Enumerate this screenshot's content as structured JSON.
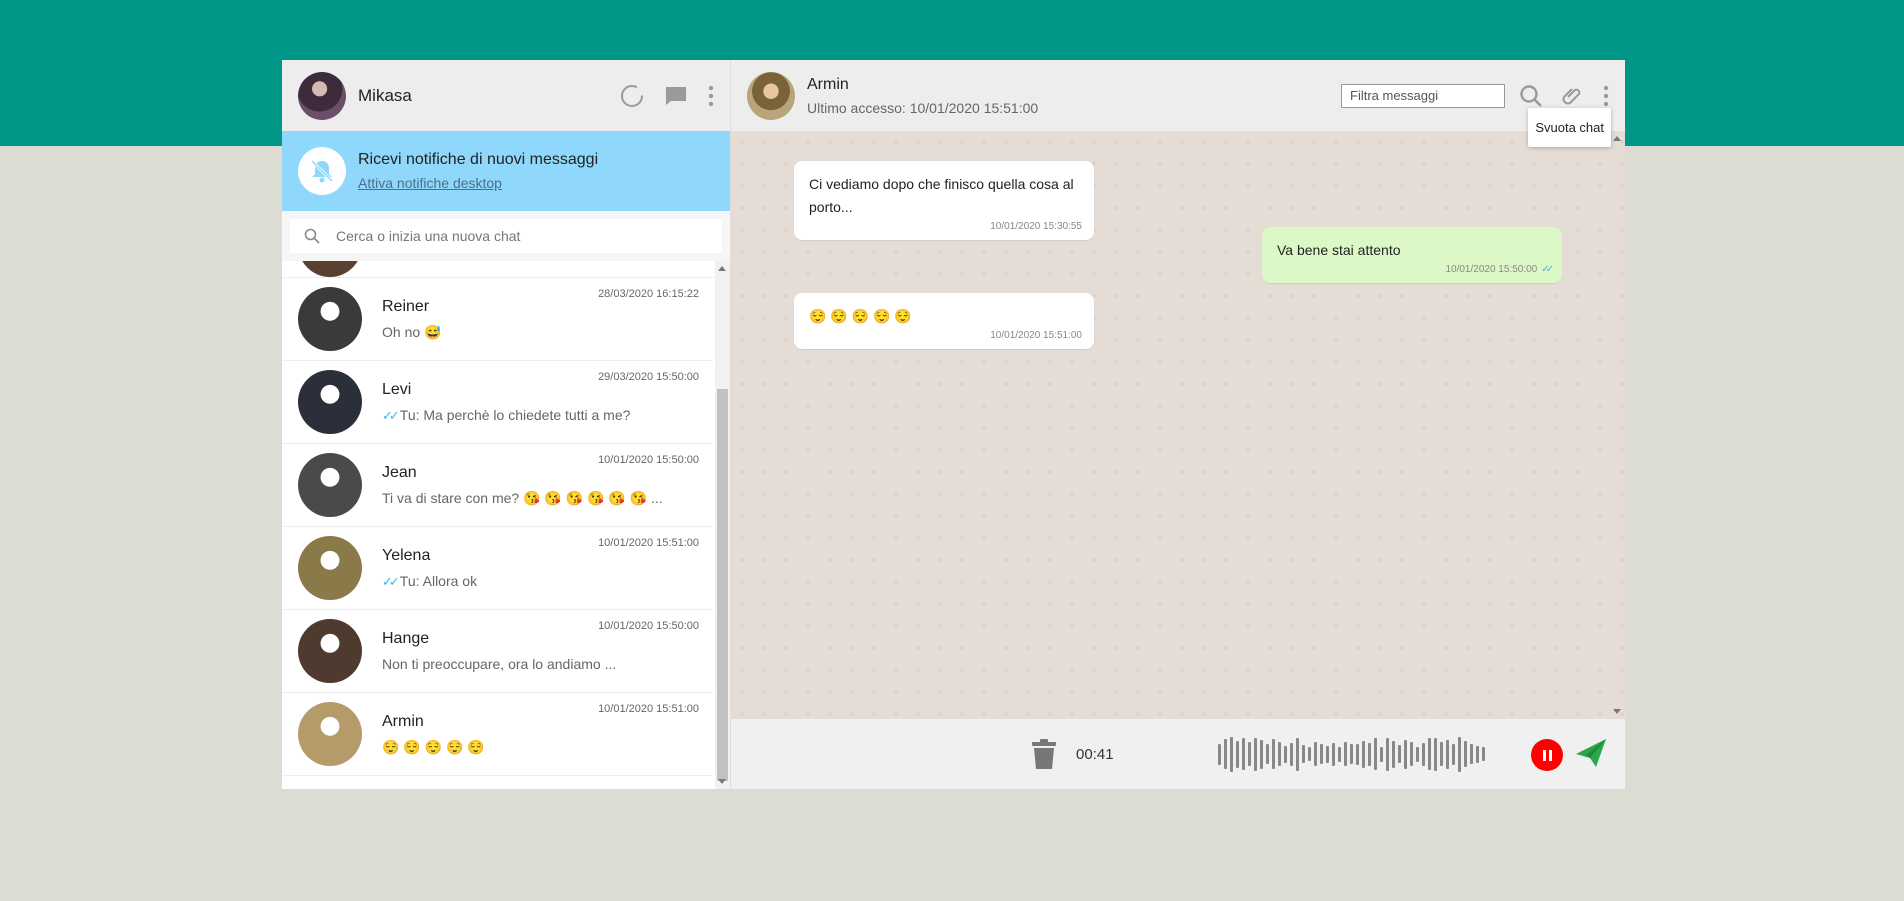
{
  "me": {
    "name": "Mikasa"
  },
  "notification": {
    "title": "Ricevi notifiche di nuovi messaggi",
    "link": "Attiva notifiche desktop"
  },
  "search": {
    "placeholder": "Cerca o inizia una nuova chat"
  },
  "chats": [
    {
      "name": "Reiner",
      "time": "28/03/2020 16:15:22",
      "last": "Oh no 😅",
      "sent_by_me": false,
      "avatar_color": "#3a3a3a"
    },
    {
      "name": "Levi",
      "time": "29/03/2020 15:50:00",
      "last": "Tu: Ma perchè lo chiedete tutti a me?",
      "sent_by_me": true,
      "avatar_color": "#2b2f3a"
    },
    {
      "name": "Jean",
      "time": "10/01/2020 15:50:00",
      "last": "Ti va di stare con me? 😘 😘 😘 😘 😘 😘 ...",
      "sent_by_me": false,
      "avatar_color": "#4a4a4a"
    },
    {
      "name": "Yelena",
      "time": "10/01/2020 15:51:00",
      "last": "Tu: Allora ok",
      "sent_by_me": true,
      "avatar_color": "#8a7a4a"
    },
    {
      "name": "Hange",
      "time": "10/01/2020 15:50:00",
      "last": "Non ti preoccupare, ora lo andiamo ...",
      "sent_by_me": false,
      "avatar_color": "#4e3a2e"
    },
    {
      "name": "Armin",
      "time": "10/01/2020 15:51:00",
      "last": "😌 😌 😌 😌 😌",
      "sent_by_me": false,
      "avatar_color": "#b59a6a"
    }
  ],
  "contact": {
    "name": "Armin",
    "last_seen": "Ultimo accesso: 10/01/2020 15:51:00"
  },
  "filter": {
    "placeholder": "Filtra messaggi"
  },
  "menu": {
    "clear_chat": "Svuota chat"
  },
  "messages": [
    {
      "direction": "in",
      "text": "Ci vediamo dopo che finisco quella cosa al porto...",
      "time": "10/01/2020 15:30:55"
    },
    {
      "direction": "out",
      "text": "Va bene stai attento",
      "time": "10/01/2020 15:50:00"
    },
    {
      "direction": "in",
      "text": "😌 😌 😌 😌 😌",
      "time": "10/01/2020 15:51:00"
    }
  ],
  "recording": {
    "timer": "00:41",
    "wave_levels": [
      0.5,
      0.8,
      0.95,
      0.7,
      0.85,
      0.6,
      0.9,
      0.75,
      0.45,
      0.8,
      0.6,
      0.35,
      0.55,
      0.9,
      0.4,
      0.25,
      0.6,
      0.45,
      0.35,
      0.55,
      0.3,
      0.6,
      0.45,
      0.5,
      0.7,
      0.55,
      0.85,
      0.3,
      0.9,
      0.7,
      0.4,
      0.75,
      0.6,
      0.3,
      0.55,
      0.85,
      0.9,
      0.6,
      0.75,
      0.5,
      0.95,
      0.65,
      0.45,
      0.35,
      0.25
    ]
  },
  "colors": {
    "brand": "#009688",
    "notification_bg": "#8fd8fb",
    "outgoing_bubble": "#dcf8c6",
    "read_ticks": "#34b7f1",
    "record_stop": "#ff0000",
    "send": "#2aa74d"
  },
  "icons": [
    "status-icon",
    "new-chat-icon",
    "menu-icon",
    "bell-off-icon",
    "search-icon",
    "attach-icon",
    "trash-icon",
    "pause-icon",
    "send-icon"
  ]
}
